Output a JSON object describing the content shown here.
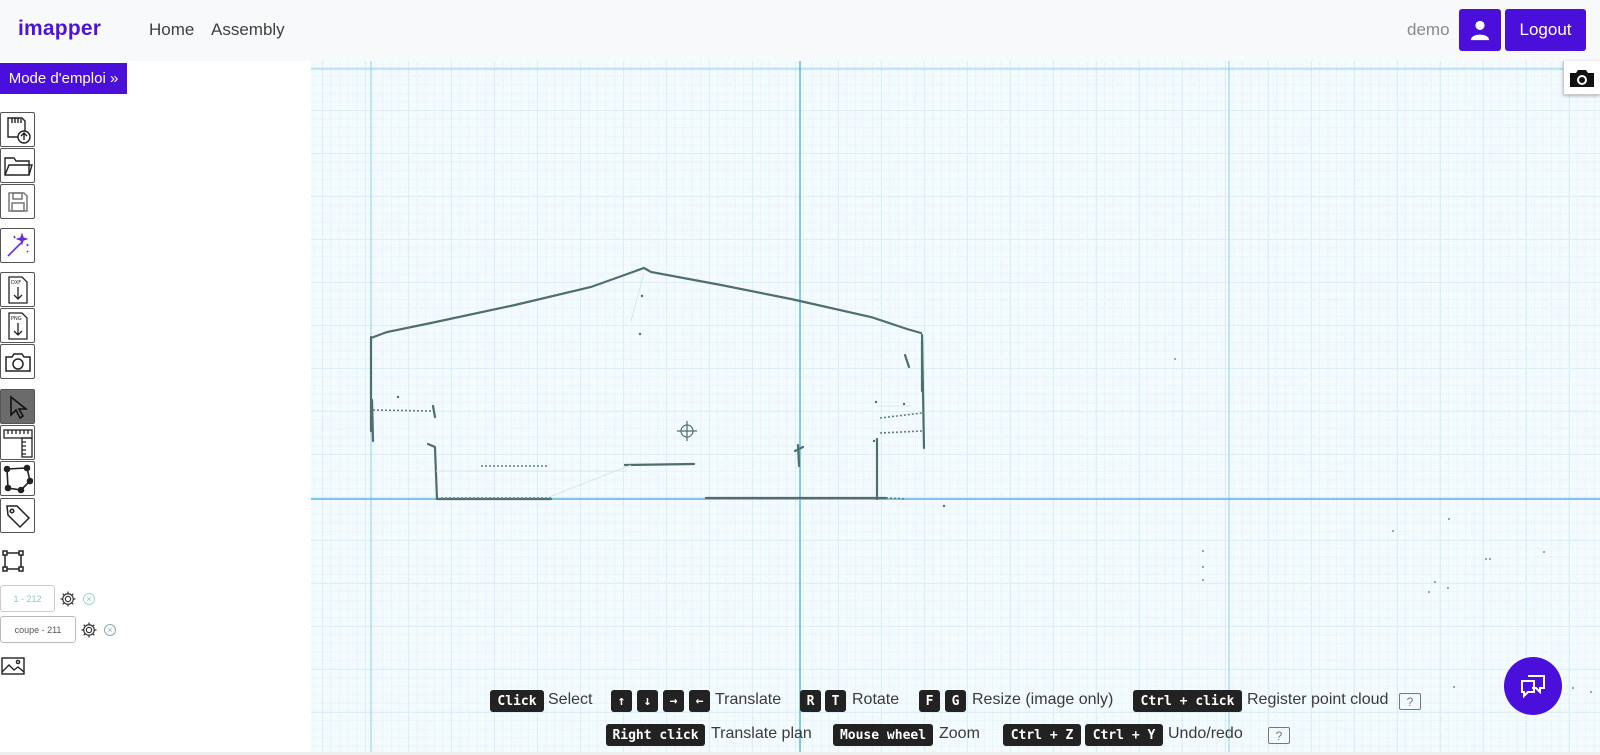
{
  "navbar": {
    "brand": "imapper",
    "links": [
      "Home",
      "Assembly"
    ],
    "username": "demo",
    "user_icon": "user-icon",
    "logout_label": "Logout"
  },
  "sidebar": {
    "mode_button": "Mode d'emploi »",
    "tools": [
      "import-sd-card-icon",
      "open-folder-icon",
      "save-icon",
      "magic-wand-icon",
      "export-dxf-icon",
      "export-png-icon",
      "camera-icon",
      "select-cursor-icon",
      "measure-ruler-icon",
      "polygon-icon",
      "tag-icon"
    ],
    "layers": [
      {
        "label": "1 - 212"
      },
      {
        "label": "coupe - 211"
      }
    ]
  },
  "shortcuts": {
    "row1": {
      "click_key": "Click",
      "click_text": "Select",
      "arrow_keys": [
        "↑",
        "↓",
        "→",
        "←"
      ],
      "arrow_text": "Translate",
      "rotate_keys": [
        "R",
        "T"
      ],
      "rotate_text": "Rotate",
      "resize_keys": [
        "F",
        "G"
      ],
      "resize_text": "Resize (image only)",
      "register_key": "Ctrl + click",
      "register_text": "Register point cloud",
      "help": "?"
    },
    "row2": {
      "rightclick_key": "Right click",
      "rightclick_text": "Translate plan",
      "wheel_key": "Mouse wheel",
      "wheel_text": "Zoom",
      "undo_keys": [
        "Ctrl + Z",
        "Ctrl + Y"
      ],
      "undo_text": "Undo/redo",
      "help": "?"
    }
  },
  "colors": {
    "accent": "#4a0fdb",
    "grid": "#dbeff9",
    "axis": "#3aa6e0",
    "plan_stroke": "#4b6b6b"
  }
}
